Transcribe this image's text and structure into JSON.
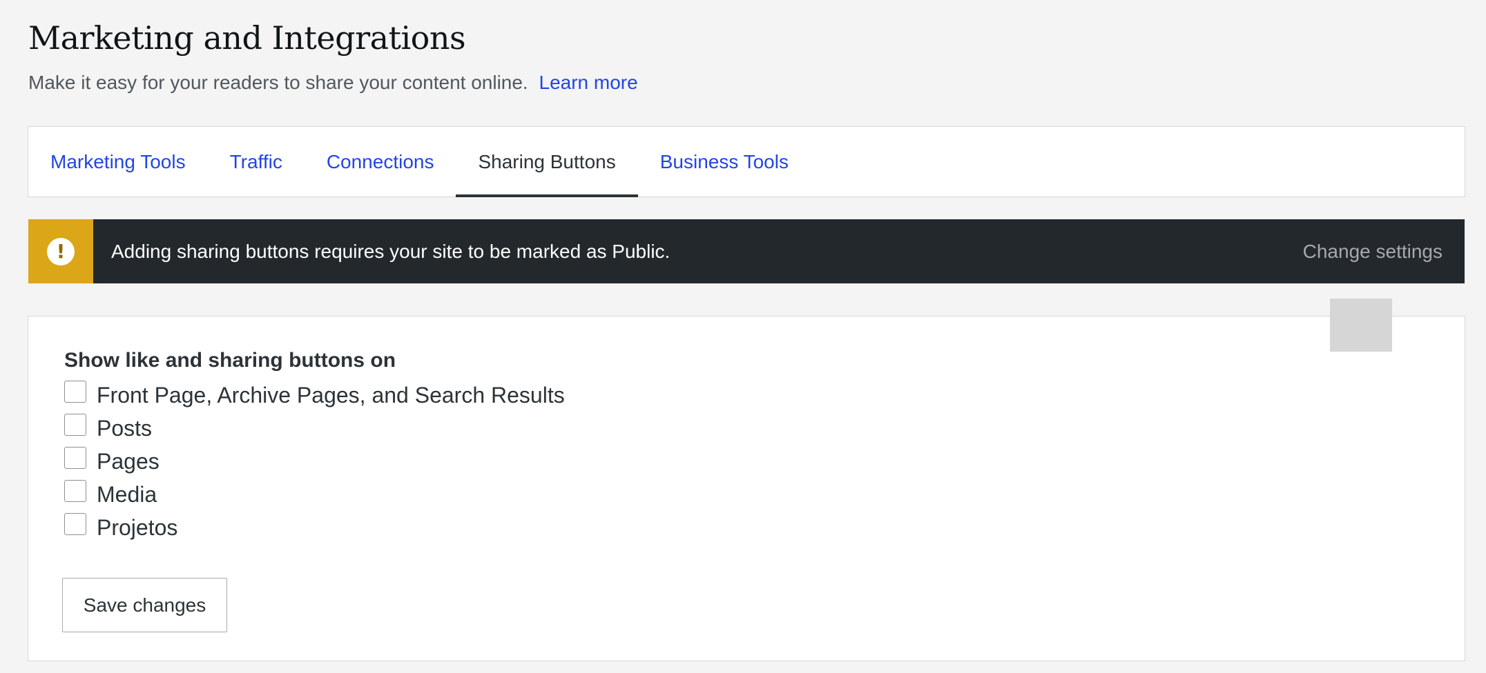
{
  "header": {
    "title": "Marketing and Integrations",
    "subtitle": "Make it easy for your readers to share your content online.",
    "learn_more": "Learn more"
  },
  "tabs": [
    {
      "label": "Marketing Tools",
      "active": false
    },
    {
      "label": "Traffic",
      "active": false
    },
    {
      "label": "Connections",
      "active": false
    },
    {
      "label": "Sharing Buttons",
      "active": true
    },
    {
      "label": "Business Tools",
      "active": false
    }
  ],
  "notice": {
    "icon": "exclamation-icon",
    "message": "Adding sharing buttons requires your site to be marked as Public.",
    "action": "Change settings"
  },
  "settings": {
    "heading": "Show like and sharing buttons on",
    "options": [
      {
        "label": "Front Page, Archive Pages, and Search Results",
        "checked": false
      },
      {
        "label": "Posts",
        "checked": false
      },
      {
        "label": "Pages",
        "checked": false
      },
      {
        "label": "Media",
        "checked": false
      },
      {
        "label": "Projetos",
        "checked": false
      }
    ],
    "save_label": "Save changes"
  },
  "colors": {
    "link": "#2145e6",
    "notice_bg": "#23282d",
    "notice_icon_bg": "#dba617",
    "page_bg": "#f3f4f3"
  }
}
